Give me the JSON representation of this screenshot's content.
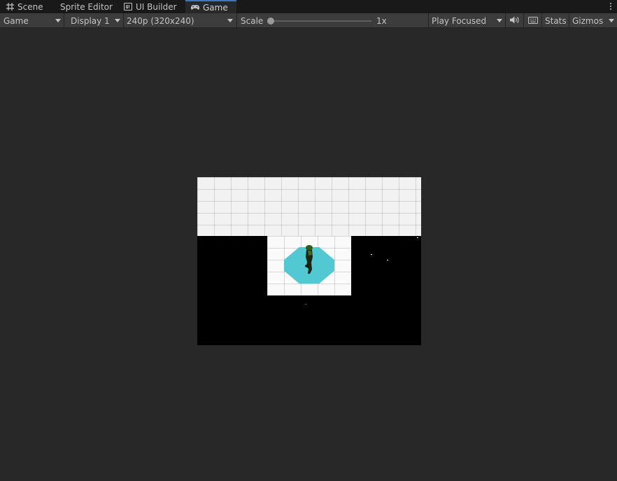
{
  "tabs": [
    {
      "label": "Scene",
      "icon": "grid-icon",
      "active": false
    },
    {
      "label": "Sprite Editor",
      "icon": "",
      "active": false
    },
    {
      "label": "UI Builder",
      "icon": "ui-builder-icon",
      "active": false
    },
    {
      "label": "Game",
      "icon": "gamepad-icon",
      "active": true
    }
  ],
  "toolbar": {
    "view_mode": "Game",
    "display": "Display 1",
    "resolution": "240p (320x240)",
    "scale_label": "Scale",
    "scale_value": "1x",
    "scale_level": 0.0,
    "play_mode": "Play Focused",
    "stats_label": "Stats",
    "gizmos_label": "Gizmos"
  },
  "colors": {
    "accent": "#3a79bb",
    "background": "#282828",
    "toolbar": "#3c3c3c",
    "octagon": "#52c8d2"
  }
}
